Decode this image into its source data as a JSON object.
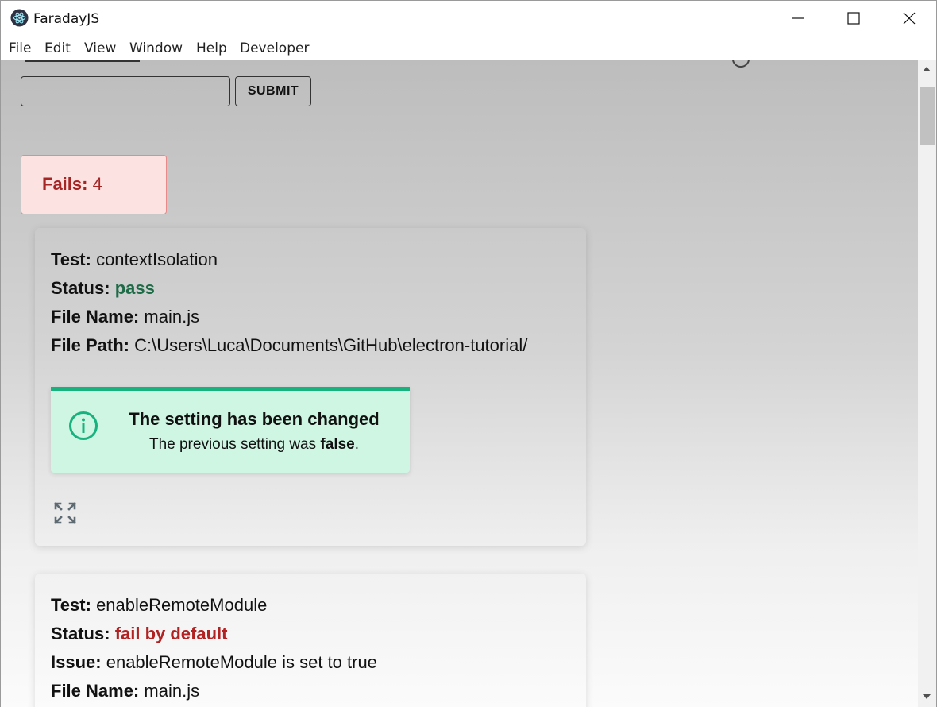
{
  "window": {
    "title": "FaradayJS"
  },
  "menu": [
    "File",
    "Edit",
    "View",
    "Window",
    "Help",
    "Developer"
  ],
  "form": {
    "input_value": "",
    "submit_label": "SUBMIT"
  },
  "fails": {
    "label": "Fails:",
    "count": "4"
  },
  "cards": [
    {
      "test_label": "Test:",
      "test": "contextIsolation",
      "status_label": "Status:",
      "status": "pass",
      "file_name_label": "File Name:",
      "file_name": "main.js",
      "file_path_label": "File Path:",
      "file_path": "C:\\Users\\Luca\\Documents\\GitHub\\electron-tutorial/",
      "alert": {
        "title": "The setting has been changed",
        "body_prefix": "The previous setting was ",
        "body_value": "false",
        "body_suffix": "."
      }
    },
    {
      "test_label": "Test:",
      "test": "enableRemoteModule",
      "status_label": "Status:",
      "status": "fail by default",
      "issue_label": "Issue:",
      "issue": "enableRemoteModule is set to true",
      "file_name_label": "File Name:",
      "file_name": "main.js"
    }
  ],
  "colors": {
    "pass": "#1e6b47",
    "fail": "#b22222",
    "alert_accent": "#17b27d",
    "alert_bg": "#cff6e3",
    "fails_bg": "#fde2e2"
  }
}
